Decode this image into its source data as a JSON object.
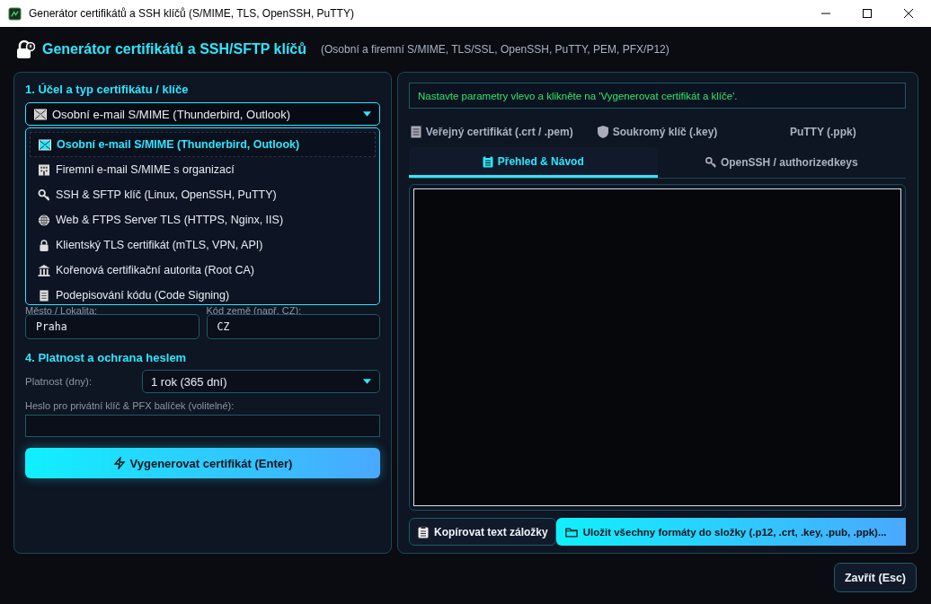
{
  "window": {
    "title": "Generátor certifikátů a SSH klíčů (S/MIME, TLS, OpenSSH, PuTTY)"
  },
  "header": {
    "title": "Generátor certifikátů a SSH/SFTP klíčů",
    "subtitle": "(Osobní a firemní S/MIME, TLS/SSL, OpenSSH, PuTTY, PEM, PFX/P12)"
  },
  "left": {
    "section_1": "1. Účel a typ certifikátu / klíče",
    "type_select": {
      "value": "Osobní e-mail S/MIME (Thunderbird, Outlook)",
      "expanded": true,
      "options": [
        {
          "label": "Osobní e-mail S/MIME (Thunderbird, Outlook)",
          "selected": true
        },
        {
          "label": "Firemní e-mail S/MIME s organizací",
          "selected": false
        },
        {
          "label": "SSH & SFTP klíč (Linux, OpenSSH, PuTTY)",
          "selected": false
        },
        {
          "label": "Web & FTPS Server TLS (HTTPS, Nginx, IIS)",
          "selected": false
        },
        {
          "label": "Klientský TLS certifikát (mTLS, VPN, API)",
          "selected": false
        },
        {
          "label": "Kořenová certifikační autorita (Root CA)",
          "selected": false
        },
        {
          "label": "Podepisování kódu (Code Signing)",
          "selected": false
        }
      ]
    },
    "city": {
      "label": "Město / Lokalita:",
      "value": "Praha"
    },
    "country": {
      "label": "Kód země (např. CZ):",
      "value": "CZ"
    },
    "section_4": "4. Platnost a ochrana heslem",
    "validity": {
      "label": "Platnost (dny):",
      "value": "1 rok (365 dní)"
    },
    "password": {
      "label": "Heslo pro privátní klíč & PFX balíček (volitelné):"
    },
    "generate_button": "Vygenerovat certifikát (Enter)"
  },
  "right": {
    "message": "Nastavte parametry vlevo a klikněte na 'Vygenerovat certifikát a klíče'.",
    "tab_rows": [
      [
        {
          "label": "Veřejný certifikát (.crt / .pem)",
          "selected": false
        },
        {
          "label": "Soukromý klíč (.key)",
          "selected": false
        },
        {
          "label": "PuTTY (.ppk)",
          "selected": false
        }
      ],
      [
        {
          "label": "Přehled & Návod",
          "selected": true
        },
        {
          "label": "OpenSSH / authorizedkeys",
          "selected": false
        }
      ]
    ],
    "copy_button": "Kopírovat text záložky",
    "save_button": "Uložit všechny formáty do složky (.p12, .crt, .key, .pub, .ppk)..."
  },
  "close_button": "Zavřít (Esc)"
}
